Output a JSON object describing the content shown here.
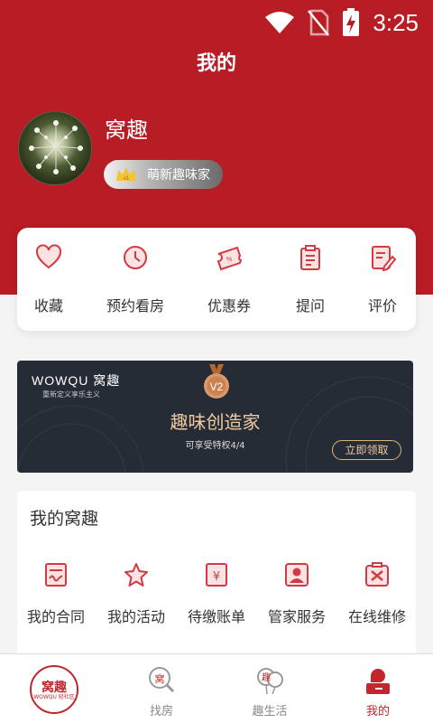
{
  "status_bar": {
    "time": "3:25"
  },
  "header": {
    "title": "我的"
  },
  "profile": {
    "name": "窝趣",
    "level_label": "萌新趣味家",
    "level_code": "v1"
  },
  "quick_actions": [
    {
      "label": "收藏",
      "icon": "heart-icon"
    },
    {
      "label": "预约看房",
      "icon": "clock-icon"
    },
    {
      "label": "优惠券",
      "icon": "coupon-icon"
    },
    {
      "label": "提问",
      "icon": "clipboard-icon"
    },
    {
      "label": "评价",
      "icon": "edit-note-icon"
    }
  ],
  "banner": {
    "brand": "WOWQU 窝趣",
    "slogan": "重新定义享乐主义",
    "medal": "V2",
    "title": "趣味创造家",
    "subtitle": "可享受特权4/4",
    "button": "立即领取"
  },
  "my_wowqu": {
    "title": "我的窝趣",
    "items": [
      {
        "label": "我的合同",
        "icon": "contract-icon"
      },
      {
        "label": "我的活动",
        "icon": "star-icon"
      },
      {
        "label": "待缴账单",
        "icon": "bill-icon"
      },
      {
        "label": "管家服务",
        "icon": "butler-icon"
      },
      {
        "label": "在线维修",
        "icon": "repair-icon"
      }
    ]
  },
  "tabbar": {
    "home_logo_main": "窝趣",
    "home_logo_sub": "WOWQU 轻社区",
    "tabs": [
      {
        "label": "找房",
        "icon": "find-house-icon"
      },
      {
        "label": "趣生活",
        "icon": "fun-life-icon"
      },
      {
        "label": "我的",
        "icon": "profile-icon"
      }
    ]
  },
  "colors": {
    "brand_red": "#b81c25",
    "accent_red": "#c1272d",
    "banner_gold": "#f0c9a0"
  }
}
